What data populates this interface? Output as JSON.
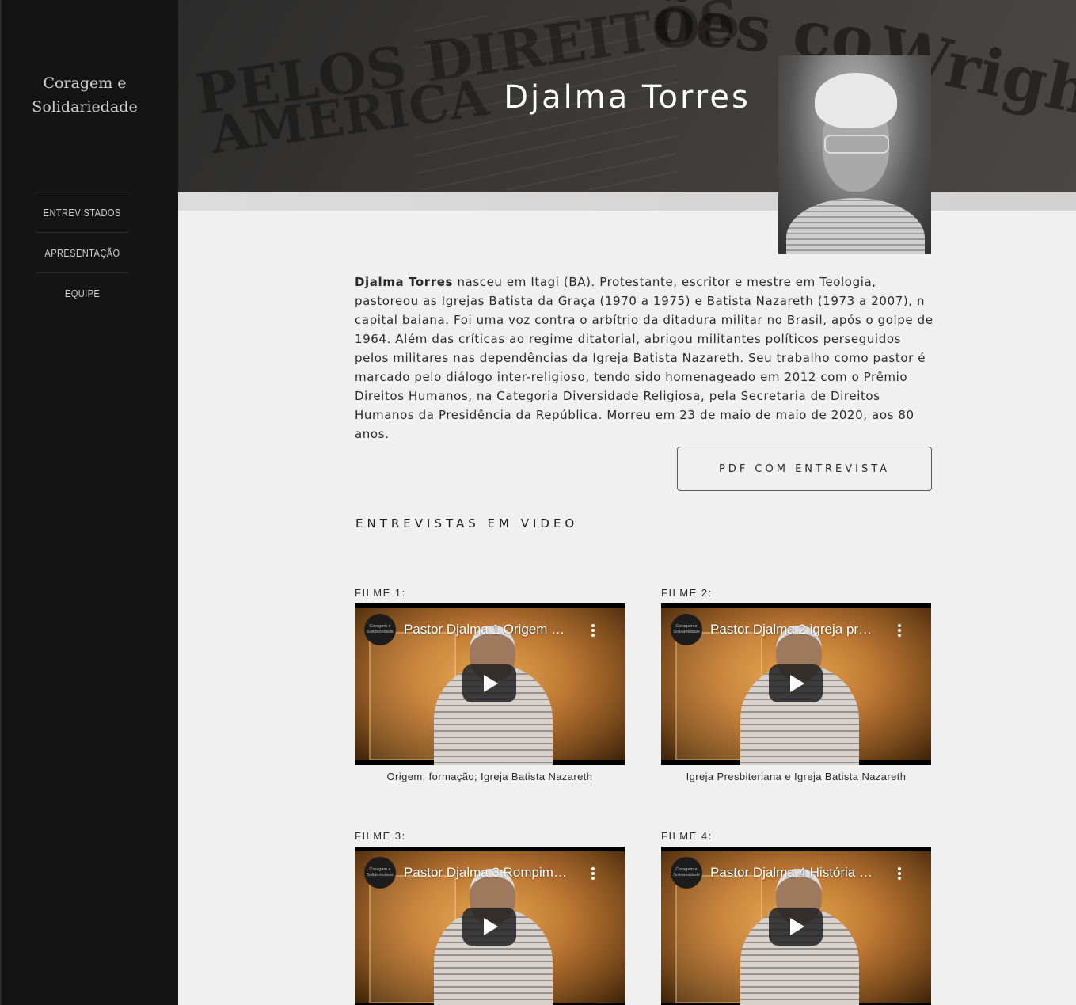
{
  "site": {
    "title": "Coragem e Solidariedade"
  },
  "nav": {
    "items": [
      {
        "label": "ENTREVISTADOS"
      },
      {
        "label": "APRESENTAÇÃO"
      },
      {
        "label": "EQUIPE"
      }
    ]
  },
  "hero": {
    "title": "Djalma Torres",
    "bg_text": [
      "PELOS DIREITOS",
      "AMERICA",
      "ões co",
      "Wright tra tor"
    ]
  },
  "bio": {
    "name": "Djalma Torres",
    "text": " nasceu em Itagi (BA). Protestante, escritor e mestre em Teologia, pastoreou as Igrejas Batista da Graça (1970 a 1975) e Batista Nazareth (1973 a 2007), n capital baiana. Foi uma voz contra o arbítrio da ditadura militar no Brasil, após o golpe de 1964. Além das críticas ao regime ditatorial, abrigou militantes políticos perseguidos pelos militares nas dependências da Igreja Batista Nazareth. Seu trabalho como pastor é marcado pelo diálogo inter-religioso, tendo sido homenageado em 2012 com o Prêmio Direitos Humanos, na Categoria Diversidade Religiosa, pela Secretaria de Direitos Humanos da Presidência da República. Morreu em 23 de maio de maio de 2020, aos 80 anos."
  },
  "pdf_button": {
    "label": "PDF COM ENTREVISTA"
  },
  "videos_section": {
    "heading": "ENTREVISTAS EM VIDEO"
  },
  "video_logo_text": "Coragem e Solidariedade",
  "films": [
    {
      "label": "FILME 1:",
      "video_title": "Pastor Djalma 1 Origem …",
      "caption": "Origem; formação; Igreja Batista Nazareth"
    },
    {
      "label": "FILME 2:",
      "video_title": "Pastor Djalma 2 igreja pr…",
      "caption": "Igreja Presbiteriana e Igreja Batista Nazareth"
    },
    {
      "label": "FILME 3:",
      "video_title": "Pastor Djalma 3 Rompim…",
      "caption": ""
    },
    {
      "label": "FILME 4:",
      "video_title": "Pastor Djalma 4 História …",
      "caption": ""
    }
  ],
  "icons": {
    "play": "play-icon",
    "menu": "more-vert-icon"
  }
}
